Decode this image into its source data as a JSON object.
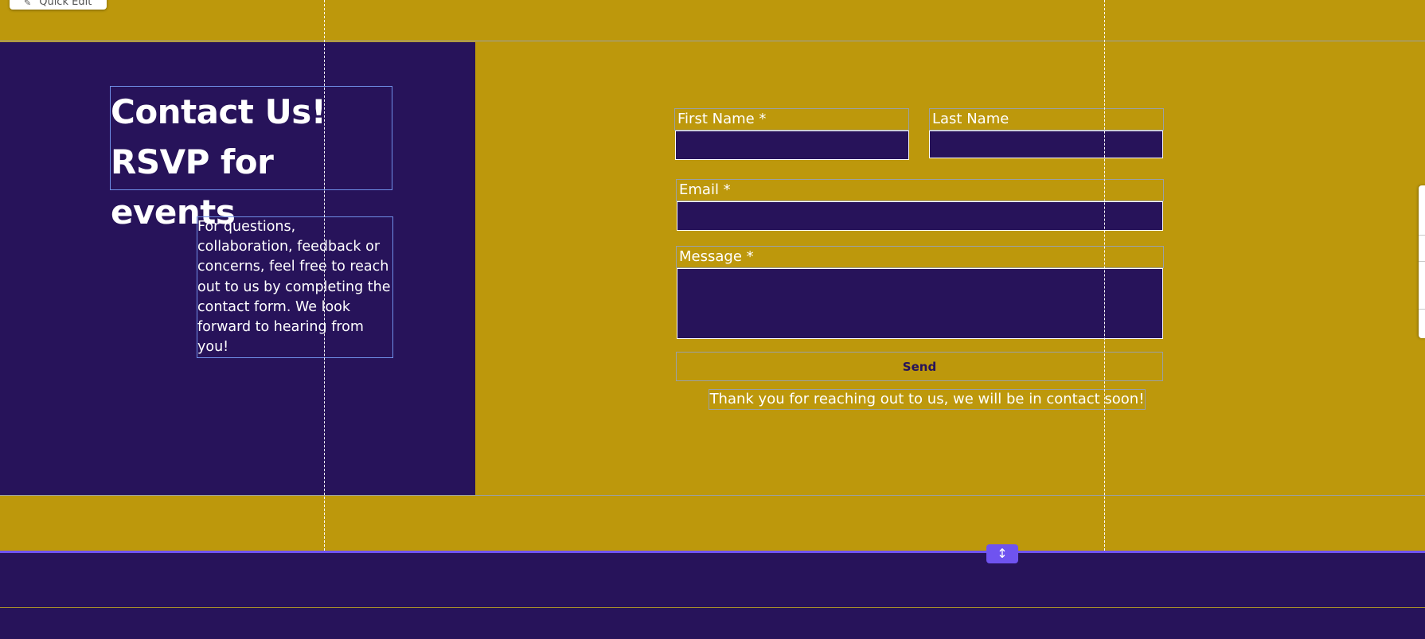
{
  "toolbar": {
    "quick_edit_label": "Quick Edit",
    "quick_edit_icon": "pencil-icon"
  },
  "contact": {
    "heading_line1": "Contact Us!",
    "heading_line2": "RSVP for events",
    "intro": "For questions, collaboration, feedback or concerns, feel free to reach out to us by completing the contact form. We look forward to hearing from you!"
  },
  "form": {
    "first_name_label": "First Name *",
    "first_name_value": "",
    "last_name_label": "Last Name",
    "last_name_value": "",
    "email_label": "Email *",
    "email_value": "",
    "message_label": "Message *",
    "message_value": "",
    "send_label": "Send",
    "thanks_message": "Thank you for reaching out to us, we will be in contact soon!"
  },
  "editor": {
    "resize_icon": "vertical-resize-icon",
    "resize_glyph": "↕"
  },
  "colors": {
    "gold": "#bd980c",
    "purple": "#27135a",
    "editor_accent": "#6f53f0",
    "text": "#ffffff"
  }
}
